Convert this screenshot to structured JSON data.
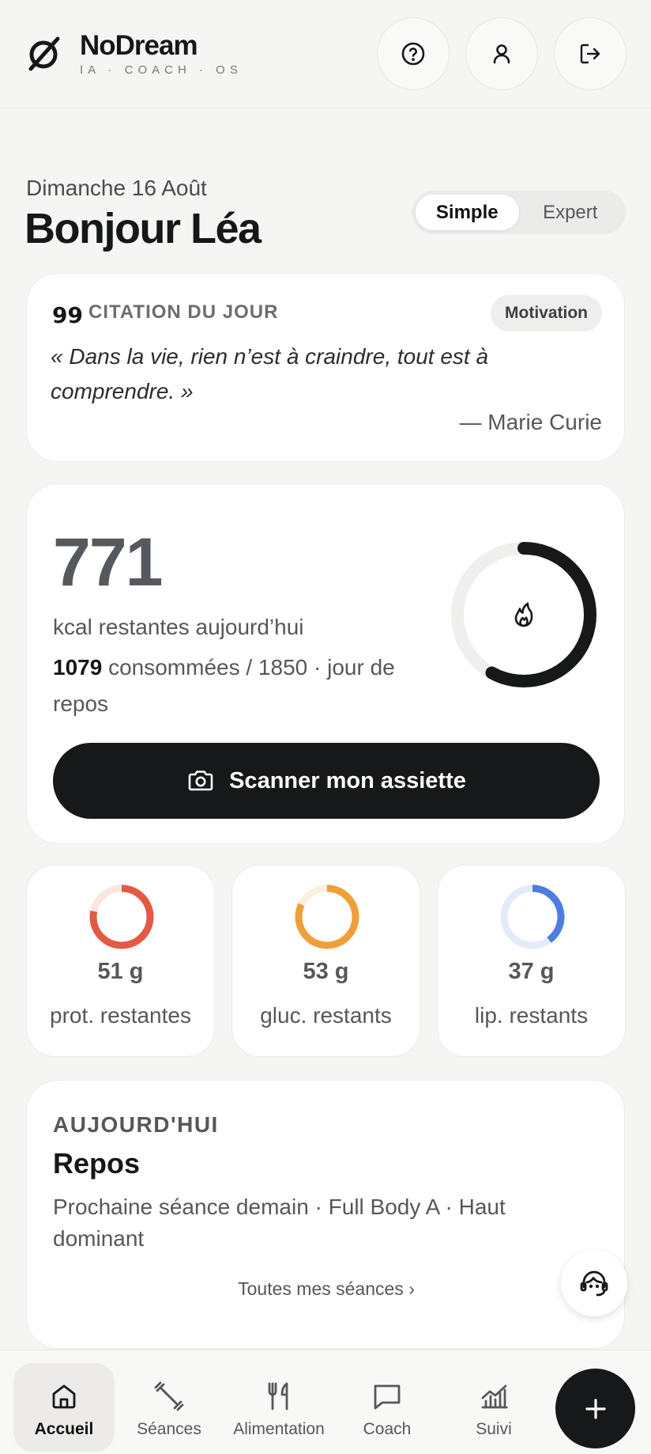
{
  "app": {
    "name": "NoDream",
    "tagline": "IA · COACH · OS"
  },
  "header": {
    "icons": [
      "help-icon",
      "user-icon",
      "logout-icon"
    ]
  },
  "greeting": {
    "date": "Dimanche 16 Août",
    "title": "Bonjour Léa"
  },
  "mode": {
    "options": [
      "Simple",
      "Expert"
    ],
    "selected": "Simple"
  },
  "quote": {
    "icon": "99",
    "title": "CITATION DU JOUR",
    "badge": "Motivation",
    "text": "« Dans la vie, rien n’est à craindre, tout est à comprendre. »",
    "author": "— Marie Curie"
  },
  "calories": {
    "remaining": "771",
    "label": "kcal restantes aujourd’hui",
    "consumed": "1079",
    "detail": " consommées / 1850 · jour de repos",
    "progress": 0.58,
    "ring_color": "#17181a",
    "icon": "flame-icon",
    "scan_label": "Scanner mon assiette"
  },
  "macros": [
    {
      "value": "51 g",
      "label": "prot. restantes",
      "progress": 0.78,
      "color": "#e25a45"
    },
    {
      "value": "53 g",
      "label": "gluc. restants",
      "progress": 0.82,
      "color": "#ef9f3a"
    },
    {
      "value": "37 g",
      "label": "lip. restants",
      "progress": 0.4,
      "color": "#4d7de0"
    }
  ],
  "today": {
    "overline": "AUJOURD'HUI",
    "title": "Repos",
    "description": "Prochaine séance demain · Full Body A · Haut dominant",
    "link": "Toutes mes séances ›"
  },
  "nav": {
    "items": [
      {
        "label": "Accueil",
        "icon": "home-icon",
        "active": true
      },
      {
        "label": "Séances",
        "icon": "dumbbell-icon",
        "active": false
      },
      {
        "label": "Alimentation",
        "icon": "fork-knife-icon",
        "active": false
      },
      {
        "label": "Coach",
        "icon": "chat-icon",
        "active": false
      },
      {
        "label": "Suivi",
        "icon": "chart-icon",
        "active": false
      }
    ],
    "add_icon": "plus-icon"
  }
}
